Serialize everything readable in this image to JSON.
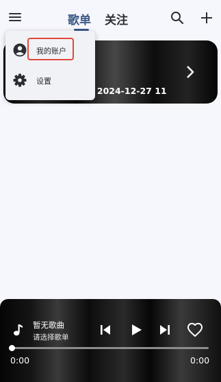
{
  "header": {
    "tabs": [
      {
        "label": "歌单",
        "active": true
      },
      {
        "label": "关注",
        "active": false
      }
    ],
    "icons": {
      "menu": "hamburger-icon",
      "search": "search-icon",
      "add": "plus-icon"
    },
    "accent_color": "#3a5a86"
  },
  "playlist_card": {
    "title": "音乐 - 2024-12-27 11:..."
  },
  "dropdown_menu": {
    "items": [
      {
        "label": "我的账户",
        "icon": "account-circle-icon"
      },
      {
        "label": "设置",
        "icon": "gear-icon"
      }
    ],
    "highlight_color": "#e0483c"
  },
  "player": {
    "song_title": "暂无歌曲",
    "song_subtitle": "请选择歌单",
    "current_time": "0:00",
    "total_time": "0:00",
    "progress": 0.0,
    "icons": {
      "note": "music-note-icon",
      "prev": "skip-previous-icon",
      "play": "play-icon",
      "next": "skip-next-icon",
      "like": "heart-outline-icon"
    }
  }
}
